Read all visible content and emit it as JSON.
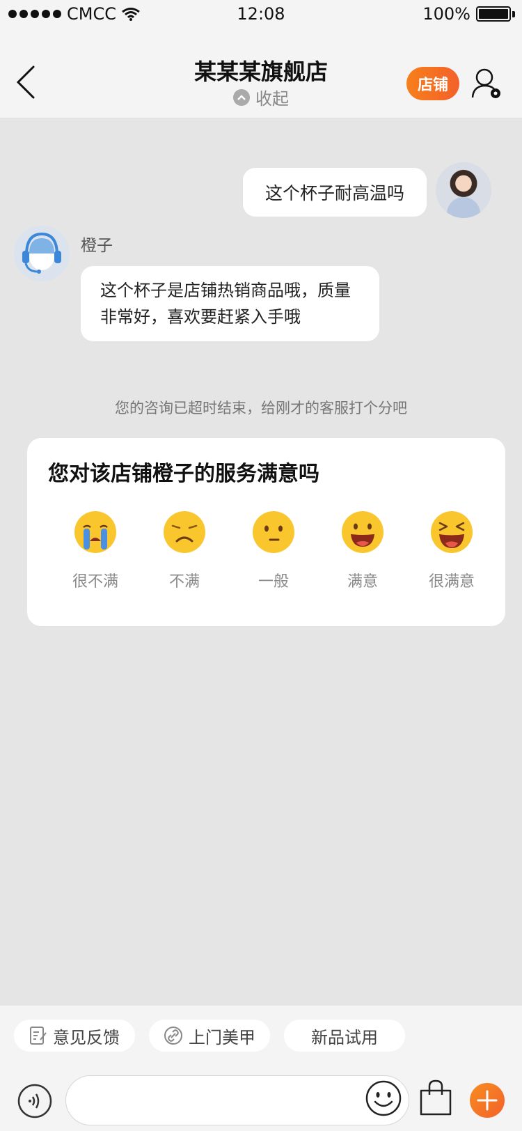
{
  "status_bar": {
    "carrier": "CMCC",
    "time": "12:08",
    "battery": "100%"
  },
  "header": {
    "title": "某某某旗舰店",
    "collapse_label": "收起",
    "store_button": "店铺"
  },
  "chat": {
    "messages": [
      {
        "from": "me",
        "text": "这个杯子耐高温吗"
      },
      {
        "from": "agent",
        "sender_name": "橙子",
        "text": "这个杯子是店铺热销商品哦，质量非常好，喜欢要赶紧入手哦"
      }
    ],
    "system_note": "您的咨询已超时结束，给刚才的客服打个分吧",
    "rating": {
      "title": "您对该店铺橙子的服务满意吗",
      "options": [
        {
          "label": "很不满",
          "icon": "crying-face-icon"
        },
        {
          "label": "不满",
          "icon": "frowning-face-icon"
        },
        {
          "label": "一般",
          "icon": "neutral-face-icon"
        },
        {
          "label": "满意",
          "icon": "smiling-face-icon"
        },
        {
          "label": "很满意",
          "icon": "laughing-face-icon"
        }
      ]
    }
  },
  "quick_replies": [
    {
      "label": "意见反馈",
      "icon": "feedback-icon"
    },
    {
      "label": "上门美甲",
      "icon": "link-icon"
    },
    {
      "label": "新品试用",
      "icon": ""
    }
  ],
  "input_bar": {
    "value": "",
    "placeholder": ""
  },
  "colors": {
    "accent": "#f3612a",
    "emoji_yellow": "#f9c62e",
    "background": "#e5e5e5"
  }
}
